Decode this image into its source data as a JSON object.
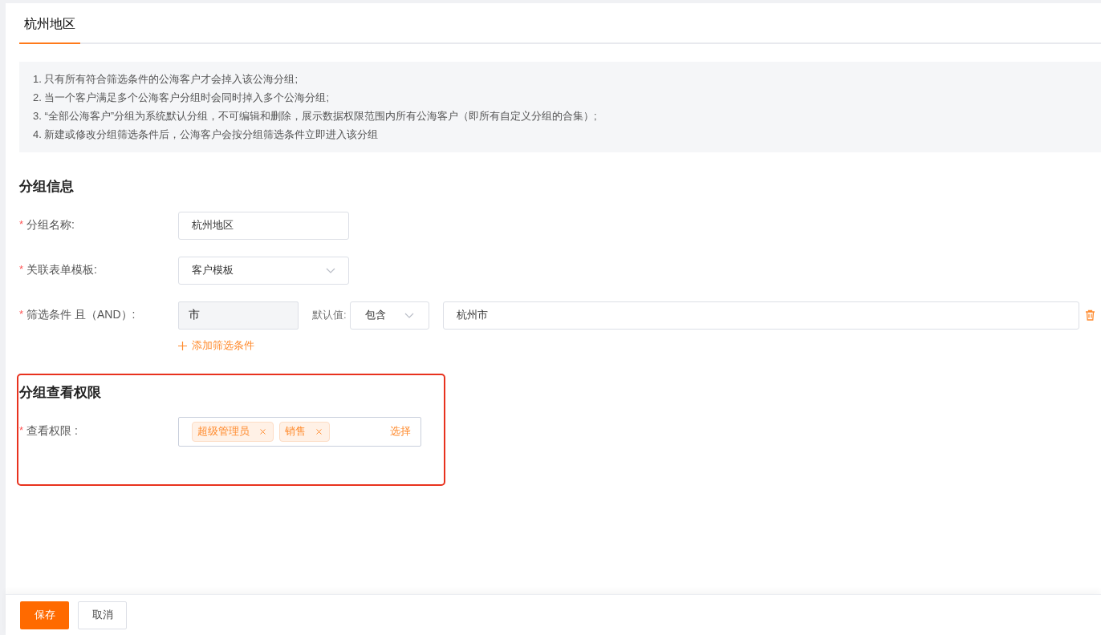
{
  "tabs": [
    {
      "label": "杭州地区",
      "selected": true
    }
  ],
  "notice": {
    "lines": [
      "1. 只有所有符合筛选条件的公海客户才会掉入该公海分组;",
      "2. 当一个客户满足多个公海客户分组时会同时掉入多个公海分组;",
      "3. “全部公海客户”分组为系统默认分组，不可编辑和删除，展示数据权限范围内所有公海客户（即所有自定义分组的合集）;",
      "4. 新建或修改分组筛选条件后，公海客户会按分组筛选条件立即进入该分组"
    ]
  },
  "group_info": {
    "title": "分组信息",
    "fields": [
      {
        "kind": "input",
        "required_mark": "*",
        "label": "分组名称:",
        "value": "杭州地区"
      },
      {
        "kind": "select",
        "required_mark": "*",
        "label": "关联表单模板:",
        "value": "客户模板"
      }
    ],
    "filter": {
      "required_mark": "*",
      "label": "筛选条件 且（AND）:",
      "field": "市",
      "default_label": "默认值:",
      "operator": "包含",
      "value": "杭州市"
    },
    "add_link": "添加筛选条件"
  },
  "permission": {
    "highlighted": true,
    "title": "分组查看权限",
    "required_mark": "*",
    "label": "查看权限 :",
    "tags": [
      "超级管理员",
      "销售"
    ],
    "select_link": "选择"
  },
  "footer": {
    "buttons": [
      {
        "label": "保存",
        "kind": "primary"
      },
      {
        "label": "取消",
        "kind": "default"
      }
    ]
  }
}
